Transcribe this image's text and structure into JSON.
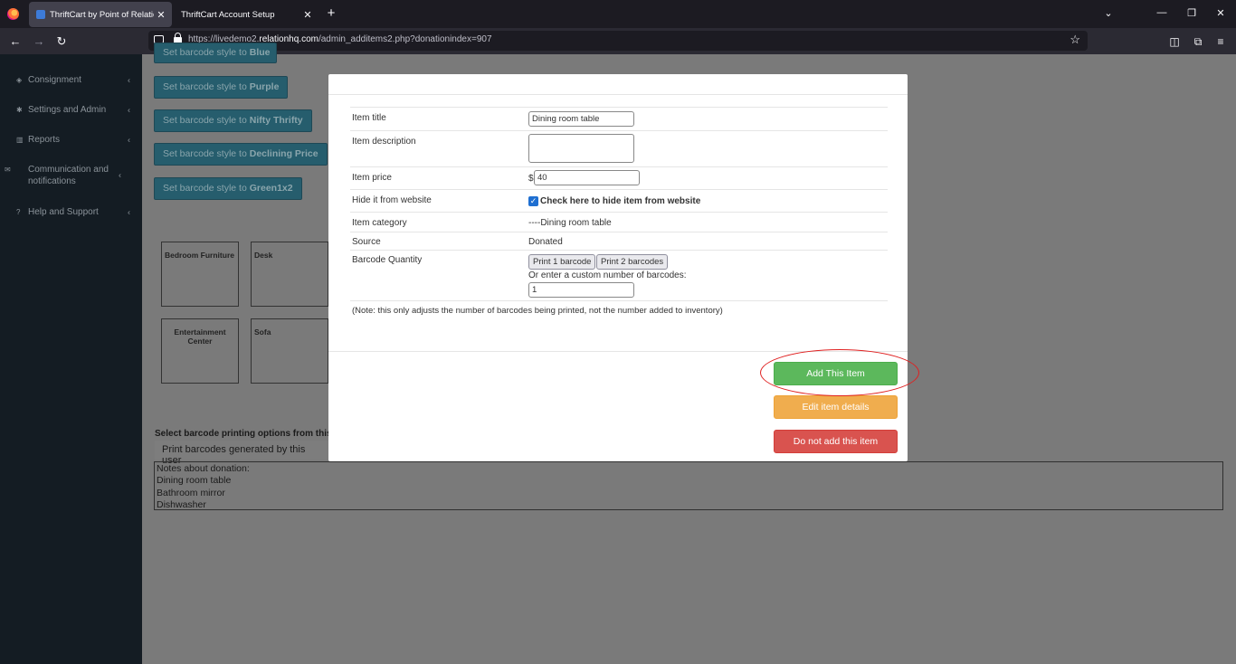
{
  "browser": {
    "tabs": [
      {
        "label": "ThriftCart by Point of Relation",
        "active": true
      },
      {
        "label": "ThriftCart Account Setup",
        "active": false
      }
    ],
    "url_prefix": "https://livedemo2.",
    "url_domain": "relationhq.com",
    "url_path": "/admin_additems2.php?donationindex=907"
  },
  "sidebar": {
    "items": [
      {
        "label": "Consignment",
        "icon": "tags-icon"
      },
      {
        "label": "Settings and Admin",
        "icon": "gear-icon"
      },
      {
        "label": "Reports",
        "icon": "bar-chart-icon"
      },
      {
        "label": "Communication and notifications",
        "icon": "envelope-icon"
      },
      {
        "label": "Help and Support",
        "icon": "question-circle-icon"
      }
    ]
  },
  "main": {
    "barcode_buttons": [
      {
        "prefix": "Set barcode style to ",
        "style": "Blue"
      },
      {
        "prefix": "Set barcode style to ",
        "style": "Purple"
      },
      {
        "prefix": "Set barcode style to ",
        "style": "Nifty Thrifty"
      },
      {
        "prefix": "Set barcode style to ",
        "style": "Declining Price"
      },
      {
        "prefix": "Set barcode style to ",
        "style": "Green1x2"
      }
    ],
    "categories": [
      "Bedroom Furniture",
      "Desk",
      "Entertainment Center",
      "Sofa"
    ],
    "print_options_label": "Select barcode printing options from this c",
    "print_options_value": "Print barcodes generated by this user",
    "notes_lines": [
      "Notes about donation:",
      "Dining room table",
      "Bathroom mirror",
      "Dishwasher"
    ]
  },
  "modal": {
    "fields": {
      "title_label": "Item title",
      "title_value": "Dining room table",
      "description_label": "Item description",
      "description_value": "",
      "price_label": "Item price",
      "price_currency": "$",
      "price_value": "40",
      "hide_label": "Hide it from website",
      "hide_checkbox_label": "Check here to hide item from website",
      "hide_checked": true,
      "category_label": "Item category",
      "category_value": "----Dining room table",
      "source_label": "Source",
      "source_value": "Donated",
      "barcode_qty_label": "Barcode Quantity",
      "print1_label": "Print 1 barcode",
      "print2_label": "Print 2 barcodes",
      "custom_qty_label": "Or enter a custom number of barcodes:",
      "custom_qty_value": "1"
    },
    "note": "(Note: this only adjusts the number of barcodes being printed, not the number added to inventory)",
    "actions": {
      "add": "Add This Item",
      "edit": "Edit item details",
      "cancel": "Do not add this item"
    }
  }
}
